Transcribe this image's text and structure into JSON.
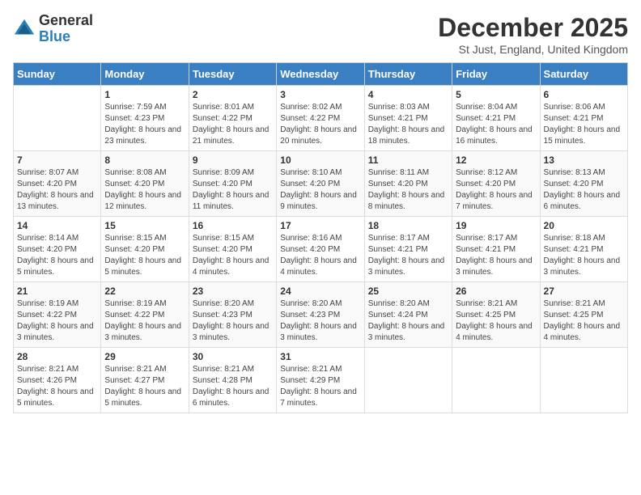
{
  "logo": {
    "general": "General",
    "blue": "Blue"
  },
  "title": "December 2025",
  "location": "St Just, England, United Kingdom",
  "days_of_week": [
    "Sunday",
    "Monday",
    "Tuesday",
    "Wednesday",
    "Thursday",
    "Friday",
    "Saturday"
  ],
  "weeks": [
    [
      {
        "day": "",
        "sunrise": "",
        "sunset": "",
        "daylight": ""
      },
      {
        "day": "1",
        "sunrise": "Sunrise: 7:59 AM",
        "sunset": "Sunset: 4:23 PM",
        "daylight": "Daylight: 8 hours and 23 minutes."
      },
      {
        "day": "2",
        "sunrise": "Sunrise: 8:01 AM",
        "sunset": "Sunset: 4:22 PM",
        "daylight": "Daylight: 8 hours and 21 minutes."
      },
      {
        "day": "3",
        "sunrise": "Sunrise: 8:02 AM",
        "sunset": "Sunset: 4:22 PM",
        "daylight": "Daylight: 8 hours and 20 minutes."
      },
      {
        "day": "4",
        "sunrise": "Sunrise: 8:03 AM",
        "sunset": "Sunset: 4:21 PM",
        "daylight": "Daylight: 8 hours and 18 minutes."
      },
      {
        "day": "5",
        "sunrise": "Sunrise: 8:04 AM",
        "sunset": "Sunset: 4:21 PM",
        "daylight": "Daylight: 8 hours and 16 minutes."
      },
      {
        "day": "6",
        "sunrise": "Sunrise: 8:06 AM",
        "sunset": "Sunset: 4:21 PM",
        "daylight": "Daylight: 8 hours and 15 minutes."
      }
    ],
    [
      {
        "day": "7",
        "sunrise": "Sunrise: 8:07 AM",
        "sunset": "Sunset: 4:20 PM",
        "daylight": "Daylight: 8 hours and 13 minutes."
      },
      {
        "day": "8",
        "sunrise": "Sunrise: 8:08 AM",
        "sunset": "Sunset: 4:20 PM",
        "daylight": "Daylight: 8 hours and 12 minutes."
      },
      {
        "day": "9",
        "sunrise": "Sunrise: 8:09 AM",
        "sunset": "Sunset: 4:20 PM",
        "daylight": "Daylight: 8 hours and 11 minutes."
      },
      {
        "day": "10",
        "sunrise": "Sunrise: 8:10 AM",
        "sunset": "Sunset: 4:20 PM",
        "daylight": "Daylight: 8 hours and 9 minutes."
      },
      {
        "day": "11",
        "sunrise": "Sunrise: 8:11 AM",
        "sunset": "Sunset: 4:20 PM",
        "daylight": "Daylight: 8 hours and 8 minutes."
      },
      {
        "day": "12",
        "sunrise": "Sunrise: 8:12 AM",
        "sunset": "Sunset: 4:20 PM",
        "daylight": "Daylight: 8 hours and 7 minutes."
      },
      {
        "day": "13",
        "sunrise": "Sunrise: 8:13 AM",
        "sunset": "Sunset: 4:20 PM",
        "daylight": "Daylight: 8 hours and 6 minutes."
      }
    ],
    [
      {
        "day": "14",
        "sunrise": "Sunrise: 8:14 AM",
        "sunset": "Sunset: 4:20 PM",
        "daylight": "Daylight: 8 hours and 5 minutes."
      },
      {
        "day": "15",
        "sunrise": "Sunrise: 8:15 AM",
        "sunset": "Sunset: 4:20 PM",
        "daylight": "Daylight: 8 hours and 5 minutes."
      },
      {
        "day": "16",
        "sunrise": "Sunrise: 8:15 AM",
        "sunset": "Sunset: 4:20 PM",
        "daylight": "Daylight: 8 hours and 4 minutes."
      },
      {
        "day": "17",
        "sunrise": "Sunrise: 8:16 AM",
        "sunset": "Sunset: 4:20 PM",
        "daylight": "Daylight: 8 hours and 4 minutes."
      },
      {
        "day": "18",
        "sunrise": "Sunrise: 8:17 AM",
        "sunset": "Sunset: 4:21 PM",
        "daylight": "Daylight: 8 hours and 3 minutes."
      },
      {
        "day": "19",
        "sunrise": "Sunrise: 8:17 AM",
        "sunset": "Sunset: 4:21 PM",
        "daylight": "Daylight: 8 hours and 3 minutes."
      },
      {
        "day": "20",
        "sunrise": "Sunrise: 8:18 AM",
        "sunset": "Sunset: 4:21 PM",
        "daylight": "Daylight: 8 hours and 3 minutes."
      }
    ],
    [
      {
        "day": "21",
        "sunrise": "Sunrise: 8:19 AM",
        "sunset": "Sunset: 4:22 PM",
        "daylight": "Daylight: 8 hours and 3 minutes."
      },
      {
        "day": "22",
        "sunrise": "Sunrise: 8:19 AM",
        "sunset": "Sunset: 4:22 PM",
        "daylight": "Daylight: 8 hours and 3 minutes."
      },
      {
        "day": "23",
        "sunrise": "Sunrise: 8:20 AM",
        "sunset": "Sunset: 4:23 PM",
        "daylight": "Daylight: 8 hours and 3 minutes."
      },
      {
        "day": "24",
        "sunrise": "Sunrise: 8:20 AM",
        "sunset": "Sunset: 4:23 PM",
        "daylight": "Daylight: 8 hours and 3 minutes."
      },
      {
        "day": "25",
        "sunrise": "Sunrise: 8:20 AM",
        "sunset": "Sunset: 4:24 PM",
        "daylight": "Daylight: 8 hours and 3 minutes."
      },
      {
        "day": "26",
        "sunrise": "Sunrise: 8:21 AM",
        "sunset": "Sunset: 4:25 PM",
        "daylight": "Daylight: 8 hours and 4 minutes."
      },
      {
        "day": "27",
        "sunrise": "Sunrise: 8:21 AM",
        "sunset": "Sunset: 4:25 PM",
        "daylight": "Daylight: 8 hours and 4 minutes."
      }
    ],
    [
      {
        "day": "28",
        "sunrise": "Sunrise: 8:21 AM",
        "sunset": "Sunset: 4:26 PM",
        "daylight": "Daylight: 8 hours and 5 minutes."
      },
      {
        "day": "29",
        "sunrise": "Sunrise: 8:21 AM",
        "sunset": "Sunset: 4:27 PM",
        "daylight": "Daylight: 8 hours and 5 minutes."
      },
      {
        "day": "30",
        "sunrise": "Sunrise: 8:21 AM",
        "sunset": "Sunset: 4:28 PM",
        "daylight": "Daylight: 8 hours and 6 minutes."
      },
      {
        "day": "31",
        "sunrise": "Sunrise: 8:21 AM",
        "sunset": "Sunset: 4:29 PM",
        "daylight": "Daylight: 8 hours and 7 minutes."
      },
      {
        "day": "",
        "sunrise": "",
        "sunset": "",
        "daylight": ""
      },
      {
        "day": "",
        "sunrise": "",
        "sunset": "",
        "daylight": ""
      },
      {
        "day": "",
        "sunrise": "",
        "sunset": "",
        "daylight": ""
      }
    ]
  ]
}
